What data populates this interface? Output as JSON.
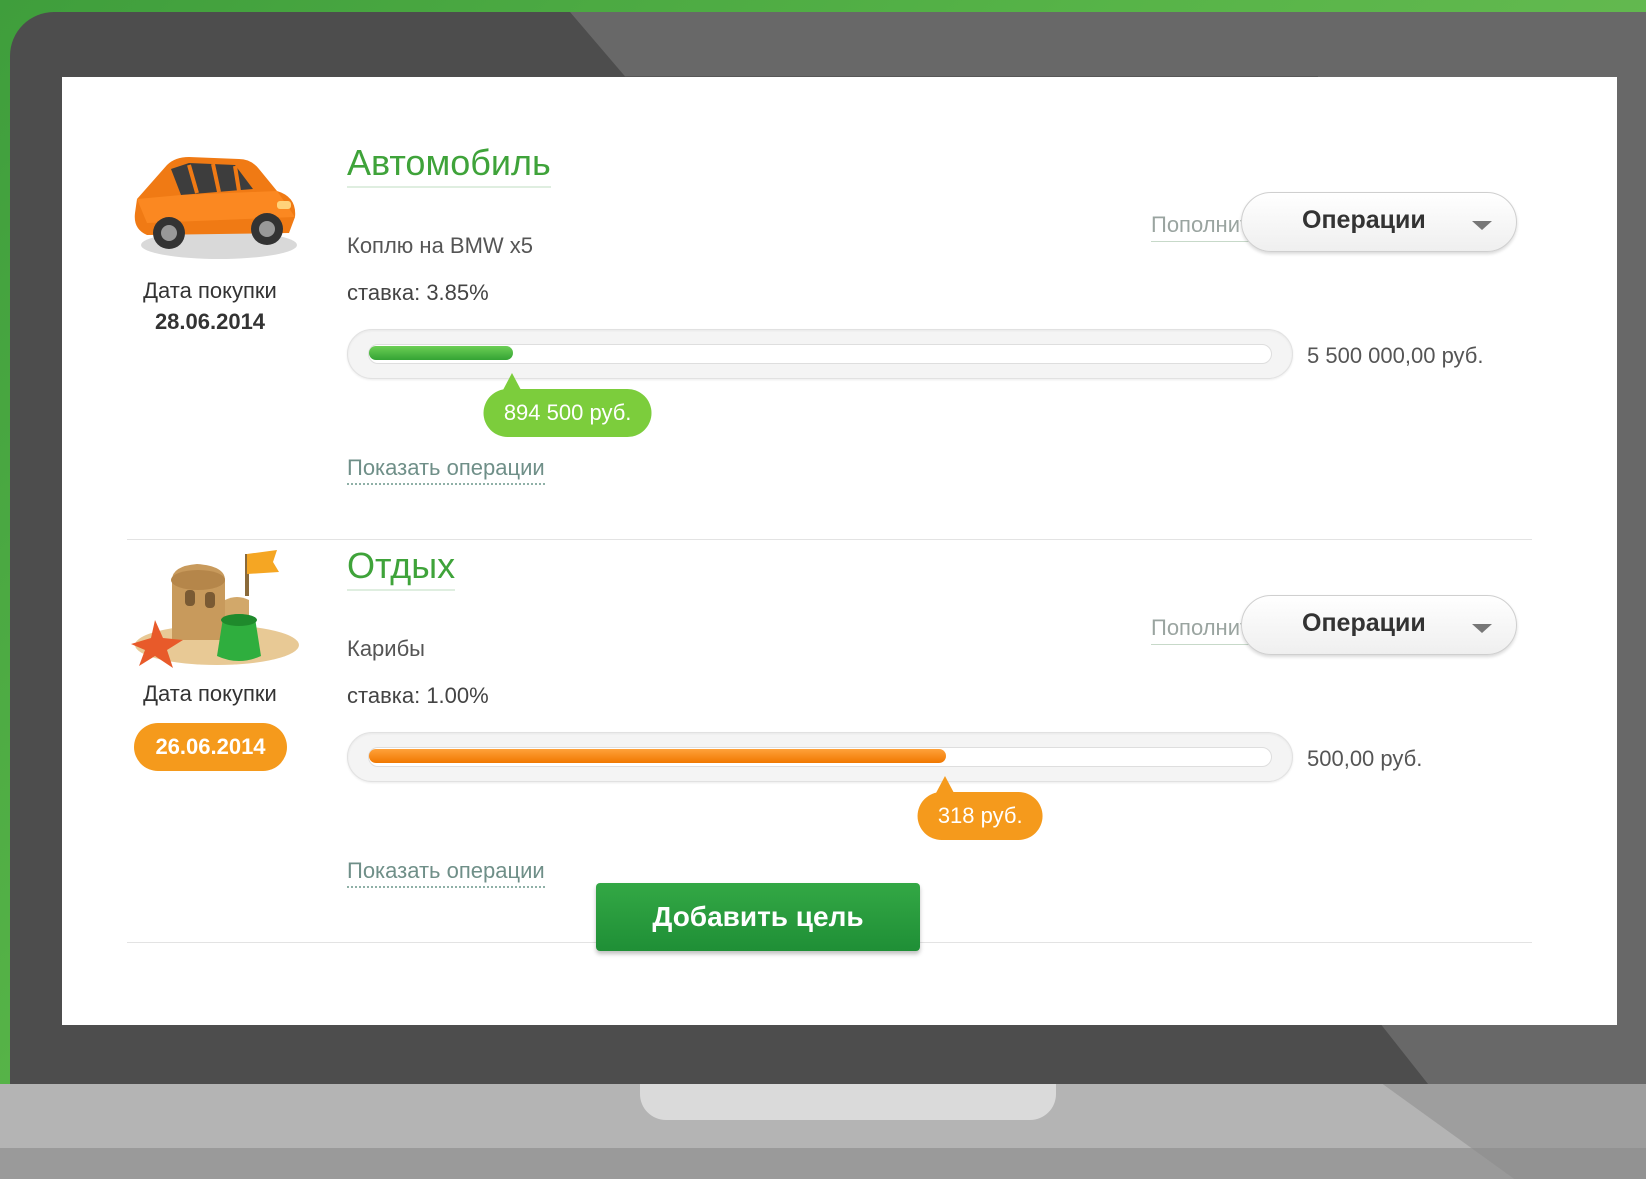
{
  "goals": [
    {
      "title": "Автомобиль",
      "description": "Коплю на BMW x5",
      "rate": "ставка: 3.85%",
      "date_label": "Дата покупки",
      "date_value": "28.06.2014",
      "replenish_label": "Пополнить",
      "operations_label": "Операции",
      "target_amount": "5 500 000,00 руб.",
      "current_amount": "894 500 руб.",
      "progress_fraction": 0.16,
      "show_operations_label": "Показать операции",
      "accent": "#7ccd3c",
      "image_icon": "car-icon"
    },
    {
      "title": "Отдых",
      "description": "Карибы",
      "rate": "ставка: 1.00%",
      "date_label": "Дата покупки",
      "date_value": "26.06.2014",
      "replenish_label": "Пополнить",
      "operations_label": "Операции",
      "target_amount": "500,00 руб.",
      "current_amount": "318 руб.",
      "progress_fraction": 0.64,
      "show_operations_label": "Показать операции",
      "accent": "#f59a1c",
      "image_icon": "sandcastle-icon"
    }
  ],
  "add_goal_label": "Добавить цель",
  "colors": {
    "brand_green": "#3fa33a",
    "button_green": "#21a038",
    "warning_orange": "#f59a1c"
  }
}
